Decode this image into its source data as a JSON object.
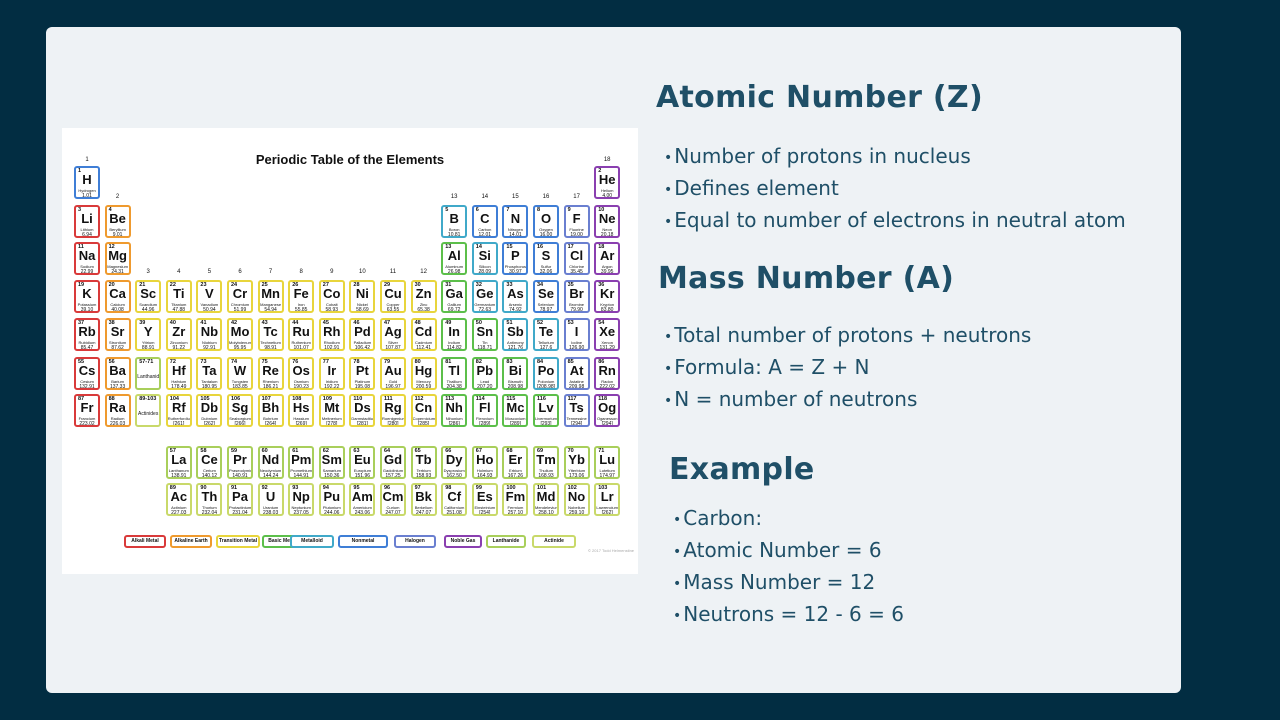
{
  "periodic_table": {
    "title": "Periodic Table of the Elements",
    "copyright": "© 2017 Todd Helmenstine",
    "groups": [
      "1",
      "2",
      "3",
      "4",
      "5",
      "6",
      "7",
      "8",
      "9",
      "10",
      "11",
      "12",
      "13",
      "14",
      "15",
      "16",
      "17",
      "18"
    ],
    "category_colors": {
      "alkali": "#d93a3a",
      "alkaline": "#ef9a2e",
      "transition": "#e8d53c",
      "basic": "#5cbf4a",
      "metalloid": "#40a9c9",
      "nonmetal": "#3f7ed6",
      "halogen": "#6a7fd0",
      "noble": "#8a3fb0",
      "lanthanide": "#a9cf5b",
      "actinide": "#c9d96a"
    },
    "elements": [
      [
        "1",
        "H",
        "Hydrogen",
        "1.01",
        1,
        1,
        "nonmetal"
      ],
      [
        "2",
        "He",
        "Helium",
        "4.00",
        1,
        18,
        "noble"
      ],
      [
        "3",
        "Li",
        "Lithium",
        "6.94",
        2,
        1,
        "alkali"
      ],
      [
        "4",
        "Be",
        "Beryllium",
        "9.01",
        2,
        2,
        "alkaline"
      ],
      [
        "5",
        "B",
        "Boron",
        "10.81",
        2,
        13,
        "metalloid"
      ],
      [
        "6",
        "C",
        "Carbon",
        "12.01",
        2,
        14,
        "nonmetal"
      ],
      [
        "7",
        "N",
        "Nitrogen",
        "14.01",
        2,
        15,
        "nonmetal"
      ],
      [
        "8",
        "O",
        "Oxygen",
        "16.00",
        2,
        16,
        "nonmetal"
      ],
      [
        "9",
        "F",
        "Fluorine",
        "19.00",
        2,
        17,
        "halogen"
      ],
      [
        "10",
        "Ne",
        "Neon",
        "20.18",
        2,
        18,
        "noble"
      ],
      [
        "11",
        "Na",
        "Sodium",
        "22.99",
        3,
        1,
        "alkali"
      ],
      [
        "12",
        "Mg",
        "Magnesium",
        "24.31",
        3,
        2,
        "alkaline"
      ],
      [
        "13",
        "Al",
        "Aluminum",
        "26.98",
        3,
        13,
        "basic"
      ],
      [
        "14",
        "Si",
        "Silicon",
        "28.09",
        3,
        14,
        "metalloid"
      ],
      [
        "15",
        "P",
        "Phosphorus",
        "30.97",
        3,
        15,
        "nonmetal"
      ],
      [
        "16",
        "S",
        "Sulfur",
        "32.06",
        3,
        16,
        "nonmetal"
      ],
      [
        "17",
        "Cl",
        "Chlorine",
        "35.45",
        3,
        17,
        "halogen"
      ],
      [
        "18",
        "Ar",
        "Argon",
        "39.95",
        3,
        18,
        "noble"
      ],
      [
        "19",
        "K",
        "Potassium",
        "39.10",
        4,
        1,
        "alkali"
      ],
      [
        "20",
        "Ca",
        "Calcium",
        "40.08",
        4,
        2,
        "alkaline"
      ],
      [
        "21",
        "Sc",
        "Scandium",
        "44.96",
        4,
        3,
        "transition"
      ],
      [
        "22",
        "Ti",
        "Titanium",
        "47.88",
        4,
        4,
        "transition"
      ],
      [
        "23",
        "V",
        "Vanadium",
        "50.94",
        4,
        5,
        "transition"
      ],
      [
        "24",
        "Cr",
        "Chromium",
        "51.99",
        4,
        6,
        "transition"
      ],
      [
        "25",
        "Mn",
        "Manganese",
        "54.94",
        4,
        7,
        "transition"
      ],
      [
        "26",
        "Fe",
        "Iron",
        "55.85",
        4,
        8,
        "transition"
      ],
      [
        "27",
        "Co",
        "Cobalt",
        "58.93",
        4,
        9,
        "transition"
      ],
      [
        "28",
        "Ni",
        "Nickel",
        "58.69",
        4,
        10,
        "transition"
      ],
      [
        "29",
        "Cu",
        "Copper",
        "63.55",
        4,
        11,
        "transition"
      ],
      [
        "30",
        "Zn",
        "Zinc",
        "65.38",
        4,
        12,
        "transition"
      ],
      [
        "31",
        "Ga",
        "Gallium",
        "69.72",
        4,
        13,
        "basic"
      ],
      [
        "32",
        "Ge",
        "Germanium",
        "72.63",
        4,
        14,
        "metalloid"
      ],
      [
        "33",
        "As",
        "Arsenic",
        "74.92",
        4,
        15,
        "metalloid"
      ],
      [
        "34",
        "Se",
        "Selenium",
        "78.97",
        4,
        16,
        "nonmetal"
      ],
      [
        "35",
        "Br",
        "Bromine",
        "79.90",
        4,
        17,
        "halogen"
      ],
      [
        "36",
        "Kr",
        "Krypton",
        "83.80",
        4,
        18,
        "noble"
      ],
      [
        "37",
        "Rb",
        "Rubidium",
        "85.47",
        5,
        1,
        "alkali"
      ],
      [
        "38",
        "Sr",
        "Strontium",
        "87.62",
        5,
        2,
        "alkaline"
      ],
      [
        "39",
        "Y",
        "Yttrium",
        "88.91",
        5,
        3,
        "transition"
      ],
      [
        "40",
        "Zr",
        "Zirconium",
        "91.22",
        5,
        4,
        "transition"
      ],
      [
        "41",
        "Nb",
        "Niobium",
        "92.91",
        5,
        5,
        "transition"
      ],
      [
        "42",
        "Mo",
        "Molybdenum",
        "95.95",
        5,
        6,
        "transition"
      ],
      [
        "43",
        "Tc",
        "Technetium",
        "98.91",
        5,
        7,
        "transition"
      ],
      [
        "44",
        "Ru",
        "Ruthenium",
        "101.07",
        5,
        8,
        "transition"
      ],
      [
        "45",
        "Rh",
        "Rhodium",
        "102.91",
        5,
        9,
        "transition"
      ],
      [
        "46",
        "Pd",
        "Palladium",
        "106.42",
        5,
        10,
        "transition"
      ],
      [
        "47",
        "Ag",
        "Silver",
        "107.87",
        5,
        11,
        "transition"
      ],
      [
        "48",
        "Cd",
        "Cadmium",
        "112.41",
        5,
        12,
        "transition"
      ],
      [
        "49",
        "In",
        "Indium",
        "114.82",
        5,
        13,
        "basic"
      ],
      [
        "50",
        "Sn",
        "Tin",
        "118.71",
        5,
        14,
        "basic"
      ],
      [
        "51",
        "Sb",
        "Antimony",
        "121.76",
        5,
        15,
        "metalloid"
      ],
      [
        "52",
        "Te",
        "Tellurium",
        "127.6",
        5,
        16,
        "metalloid"
      ],
      [
        "53",
        "I",
        "Iodine",
        "126.90",
        5,
        17,
        "halogen"
      ],
      [
        "54",
        "Xe",
        "Xenon",
        "131.29",
        5,
        18,
        "noble"
      ],
      [
        "55",
        "Cs",
        "Cesium",
        "132.91",
        6,
        1,
        "alkali"
      ],
      [
        "56",
        "Ba",
        "Barium",
        "137.33",
        6,
        2,
        "alkaline"
      ],
      [
        "57-71",
        "Lanthanides",
        "",
        "",
        6,
        3,
        "lanthanide"
      ],
      [
        "72",
        "Hf",
        "Hafnium",
        "178.49",
        6,
        4,
        "transition"
      ],
      [
        "73",
        "Ta",
        "Tantalum",
        "180.95",
        6,
        5,
        "transition"
      ],
      [
        "74",
        "W",
        "Tungsten",
        "183.85",
        6,
        6,
        "transition"
      ],
      [
        "75",
        "Re",
        "Rhenium",
        "186.21",
        6,
        7,
        "transition"
      ],
      [
        "76",
        "Os",
        "Osmium",
        "190.23",
        6,
        8,
        "transition"
      ],
      [
        "77",
        "Ir",
        "Iridium",
        "192.22",
        6,
        9,
        "transition"
      ],
      [
        "78",
        "Pt",
        "Platinum",
        "195.08",
        6,
        10,
        "transition"
      ],
      [
        "79",
        "Au",
        "Gold",
        "196.97",
        6,
        11,
        "transition"
      ],
      [
        "80",
        "Hg",
        "Mercury",
        "200.59",
        6,
        12,
        "transition"
      ],
      [
        "81",
        "Tl",
        "Thallium",
        "204.38",
        6,
        13,
        "basic"
      ],
      [
        "82",
        "Pb",
        "Lead",
        "207.20",
        6,
        14,
        "basic"
      ],
      [
        "83",
        "Bi",
        "Bismuth",
        "208.98",
        6,
        15,
        "basic"
      ],
      [
        "84",
        "Po",
        "Polonium",
        "[208.98]",
        6,
        16,
        "metalloid"
      ],
      [
        "85",
        "At",
        "Astatine",
        "209.98",
        6,
        17,
        "halogen"
      ],
      [
        "86",
        "Rn",
        "Radon",
        "222.02",
        6,
        18,
        "noble"
      ],
      [
        "87",
        "Fr",
        "Francium",
        "223.02",
        7,
        1,
        "alkali"
      ],
      [
        "88",
        "Ra",
        "Radium",
        "226.03",
        7,
        2,
        "alkaline"
      ],
      [
        "89-103",
        "Actinides",
        "",
        "",
        7,
        3,
        "actinide"
      ],
      [
        "104",
        "Rf",
        "Rutherfordium",
        "[261]",
        7,
        4,
        "transition"
      ],
      [
        "105",
        "Db",
        "Dubnium",
        "[262]",
        7,
        5,
        "transition"
      ],
      [
        "106",
        "Sg",
        "Seaborgium",
        "[266]",
        7,
        6,
        "transition"
      ],
      [
        "107",
        "Bh",
        "Bohrium",
        "[264]",
        7,
        7,
        "transition"
      ],
      [
        "108",
        "Hs",
        "Hassium",
        "[269]",
        7,
        8,
        "transition"
      ],
      [
        "109",
        "Mt",
        "Meitnerium",
        "[278]",
        7,
        9,
        "transition"
      ],
      [
        "110",
        "Ds",
        "Darmstadtium",
        "[281]",
        7,
        10,
        "transition"
      ],
      [
        "111",
        "Rg",
        "Roentgenium",
        "[280]",
        7,
        11,
        "transition"
      ],
      [
        "112",
        "Cn",
        "Copernicium",
        "[285]",
        7,
        12,
        "transition"
      ],
      [
        "113",
        "Nh",
        "Nihonium",
        "[286]",
        7,
        13,
        "basic"
      ],
      [
        "114",
        "Fl",
        "Flerovium",
        "[289]",
        7,
        14,
        "basic"
      ],
      [
        "115",
        "Mc",
        "Moscovium",
        "[289]",
        7,
        15,
        "basic"
      ],
      [
        "116",
        "Lv",
        "Livermorium",
        "[293]",
        7,
        16,
        "basic"
      ],
      [
        "117",
        "Ts",
        "Tennessine",
        "[294]",
        7,
        17,
        "halogen"
      ],
      [
        "118",
        "Og",
        "Oganesson",
        "[294]",
        7,
        18,
        "noble"
      ],
      [
        "57",
        "La",
        "Lanthanum",
        "138.91",
        9,
        4,
        "lanthanide"
      ],
      [
        "58",
        "Ce",
        "Cerium",
        "140.12",
        9,
        5,
        "lanthanide"
      ],
      [
        "59",
        "Pr",
        "Praseodymium",
        "140.91",
        9,
        6,
        "lanthanide"
      ],
      [
        "60",
        "Nd",
        "Neodymium",
        "144.24",
        9,
        7,
        "lanthanide"
      ],
      [
        "61",
        "Pm",
        "Promethium",
        "144.91",
        9,
        8,
        "lanthanide"
      ],
      [
        "62",
        "Sm",
        "Samarium",
        "150.36",
        9,
        9,
        "lanthanide"
      ],
      [
        "63",
        "Eu",
        "Europium",
        "151.96",
        9,
        10,
        "lanthanide"
      ],
      [
        "64",
        "Gd",
        "Gadolinium",
        "157.25",
        9,
        11,
        "lanthanide"
      ],
      [
        "65",
        "Tb",
        "Terbium",
        "158.93",
        9,
        12,
        "lanthanide"
      ],
      [
        "66",
        "Dy",
        "Dysprosium",
        "162.50",
        9,
        13,
        "lanthanide"
      ],
      [
        "67",
        "Ho",
        "Holmium",
        "164.93",
        9,
        14,
        "lanthanide"
      ],
      [
        "68",
        "Er",
        "Erbium",
        "167.26",
        9,
        15,
        "lanthanide"
      ],
      [
        "69",
        "Tm",
        "Thulium",
        "168.93",
        9,
        16,
        "lanthanide"
      ],
      [
        "70",
        "Yb",
        "Ytterbium",
        "173.06",
        9,
        17,
        "lanthanide"
      ],
      [
        "71",
        "Lu",
        "Lutetium",
        "174.97",
        9,
        18,
        "lanthanide"
      ],
      [
        "89",
        "Ac",
        "Actinium",
        "227.03",
        10,
        4,
        "actinide"
      ],
      [
        "90",
        "Th",
        "Thorium",
        "232.04",
        10,
        5,
        "actinide"
      ],
      [
        "91",
        "Pa",
        "Protactinium",
        "231.04",
        10,
        6,
        "actinide"
      ],
      [
        "92",
        "U",
        "Uranium",
        "238.03",
        10,
        7,
        "actinide"
      ],
      [
        "93",
        "Np",
        "Neptunium",
        "237.05",
        10,
        8,
        "actinide"
      ],
      [
        "94",
        "Pu",
        "Plutonium",
        "244.06",
        10,
        9,
        "actinide"
      ],
      [
        "95",
        "Am",
        "Americium",
        "243.06",
        10,
        10,
        "actinide"
      ],
      [
        "96",
        "Cm",
        "Curium",
        "247.07",
        10,
        11,
        "actinide"
      ],
      [
        "97",
        "Bk",
        "Berkelium",
        "247.07",
        10,
        12,
        "actinide"
      ],
      [
        "98",
        "Cf",
        "Californium",
        "251.08",
        10,
        13,
        "actinide"
      ],
      [
        "99",
        "Es",
        "Einsteinium",
        "[254]",
        10,
        14,
        "actinide"
      ],
      [
        "100",
        "Fm",
        "Fermium",
        "257.10",
        10,
        15,
        "actinide"
      ],
      [
        "101",
        "Md",
        "Mendelevium",
        "258.10",
        10,
        16,
        "actinide"
      ],
      [
        "102",
        "No",
        "Nobelium",
        "259.10",
        10,
        17,
        "actinide"
      ],
      [
        "103",
        "Lr",
        "Lawrencium",
        "[262]",
        10,
        18,
        "actinide"
      ]
    ],
    "legend": [
      [
        "Alkali Metal",
        "alkali"
      ],
      [
        "Alkaline Earth",
        "alkaline"
      ],
      [
        "Transition Metal",
        "transition"
      ],
      [
        "Basic Metal",
        "basic"
      ],
      [
        "Metalloid",
        "metalloid"
      ],
      [
        "Nonmetal",
        "nonmetal"
      ],
      [
        "Halogen",
        "halogen"
      ],
      [
        "Noble Gas",
        "noble"
      ],
      [
        "Lanthanide",
        "lanthanide"
      ],
      [
        "Actinide",
        "actinide"
      ]
    ]
  },
  "atomic_number": {
    "heading": "Atomic Number (Z)",
    "bullets": [
      "Number of protons in nucleus",
      "Defines element",
      "Equal to number of electrons in neutral atom"
    ]
  },
  "mass_number": {
    "heading": "Mass Number (A)",
    "bullets": [
      "Total number of protons + neutrons",
      "Formula: A = Z + N",
      "N = number of neutrons"
    ]
  },
  "example": {
    "heading": "Example",
    "bullets": [
      "Carbon:",
      "Atomic Number = 6",
      "Mass Number = 12",
      "Neutrons = 12 - 6 = 6"
    ]
  },
  "bullet_glyph": "•"
}
